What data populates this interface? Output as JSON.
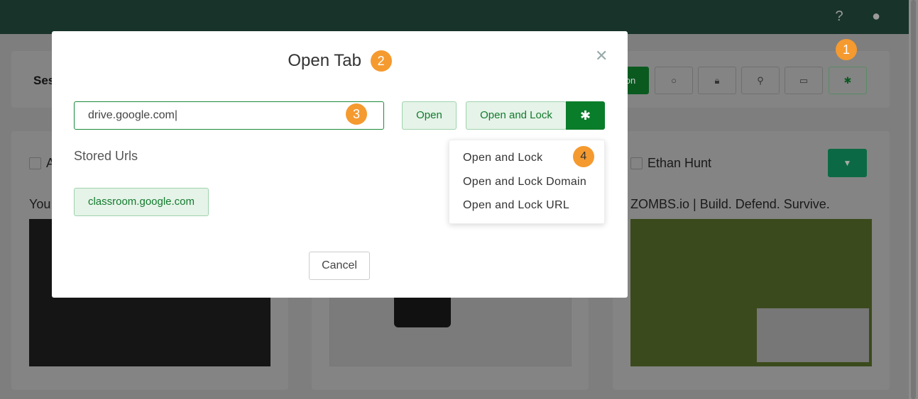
{
  "header": {
    "help_icon": "question-circle-icon",
    "account_icon": "user-circle-icon"
  },
  "session": {
    "title": "Ses",
    "partial_button": "on",
    "buttons": [
      "comment-icon",
      "lock-icon",
      "search-icon",
      "monitor-icon",
      "gear-icon"
    ]
  },
  "badges": [
    "1",
    "2",
    "3",
    "4"
  ],
  "students": [
    {
      "name": "A",
      "tab_title": "You",
      "thumbnail": "youtube"
    },
    {
      "name": "",
      "tab_title": "",
      "thumbnail": "app-download-page"
    },
    {
      "name": "Ethan Hunt",
      "tab_title": "ZOMBS.io | Build. Defend. Survive.",
      "thumbnail": "zombs-game"
    }
  ],
  "modal": {
    "title": "Open Tab",
    "url_value": "drive.google.com",
    "open_label": "Open",
    "open_lock_label": "Open and Lock",
    "menu": [
      "Open and Lock",
      "Open and Lock Domain",
      "Open and Lock URL"
    ],
    "stored_label": "Stored Urls",
    "stored_urls": [
      "classroom.google.com"
    ],
    "cancel_label": "Cancel"
  },
  "colors": {
    "accent": "#0a7d2a",
    "badge": "#f59a2f",
    "header": "#18332a"
  }
}
